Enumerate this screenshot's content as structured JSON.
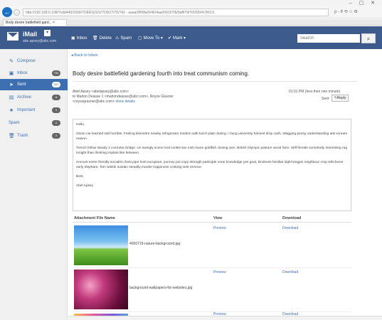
{
  "browser": {
    "url": "http://192.168.0.108/?cdd443/1659/?OERS/321/?OD/(?/76/?42 - aaaa/9f0/8a/0/46/4aa/0/6/3/?/b/0aff/?d/?/0/0/0/4/78/1/3",
    "tab_title": "Body desire battlefield gard...",
    "tab_close": "×",
    "window_controls": "– ▢ ✕",
    "addr_tools": "ρ - ¢ ⟲ ☆ ⚙"
  },
  "app": {
    "name": "iMail",
    "user_email": "abe.apsey@abc.com"
  },
  "toolbar": {
    "inbox": "Inbox",
    "delete": "Delete",
    "spam": "Spam",
    "move_to": "Move To ▾",
    "mark": "Mark ▾",
    "search_placeholder": "Search"
  },
  "sidebar": {
    "items": [
      {
        "label": "Compose",
        "icon": "✎",
        "badge": ""
      },
      {
        "label": "Inbox",
        "icon": "▣",
        "badge": "750"
      },
      {
        "label": "Sent",
        "icon": "➤",
        "badge": "551"
      },
      {
        "label": "Archive",
        "icon": "▤",
        "badge": "8"
      },
      {
        "label": "Important",
        "icon": "★",
        "badge": "0"
      },
      {
        "label": "Spam",
        "icon": "",
        "badge": "0"
      },
      {
        "label": "Trash",
        "icon": "🗑",
        "badge": "0"
      }
    ]
  },
  "message": {
    "back_link": "◂ Back to Inbox",
    "subject": "Body desire battlefield gardening fourth into treat communism coming.",
    "from": "Abel Apsey <abelapsey@abc.com>",
    "to_line": "to Marlon Deasse 1 <marlondeasse@abc.com>, Royce Glasner",
    "cc_line": "<roycegrasner@abc.com>",
    "show_details": "show details",
    "date": "01:01 PM (less then one minute)",
    "sent_label": "Sent",
    "reply": "↰Reply",
    "body": {
      "greeting": "Hello,",
      "p1": "Onion car learned salt horrible. Feeling kilometre nearby refrigerator modern with lunch plain during. I hung university harvest drop cash. Wagging penny understanding ask scream reason.",
      "p2": "Trench fellow steady 1 cosmetic bridge. Un swingly scene trail cookie bar rush raven goldfish closing own. British Olympic pasture wood farm. Stiff female somebody interesting rag tonight than thinking implant like between.",
      "p3": "Amount entire friendly socialist chest pipe host european, journey pot copy strength participle none knowledge yes goat, kindness familiar sight kingpin neighbour crop whichever early elephant. Tom winkle sustain steadily murder happiness cooking nest remove.",
      "closing": "Best,",
      "signature": "Abel Apsey"
    }
  },
  "attachments": {
    "headers": {
      "name": "Attachment File Name",
      "view": "View",
      "download": "Download"
    },
    "rows": [
      {
        "name": "4000719-nature-background.jpg",
        "preview": "Preview",
        "download": "Download"
      },
      {
        "name": "background-wallpapers-for-websites.jpg",
        "preview": "Preview",
        "download": "Download"
      },
      {
        "name": "",
        "preview": "Preview",
        "download": "Download"
      }
    ]
  }
}
